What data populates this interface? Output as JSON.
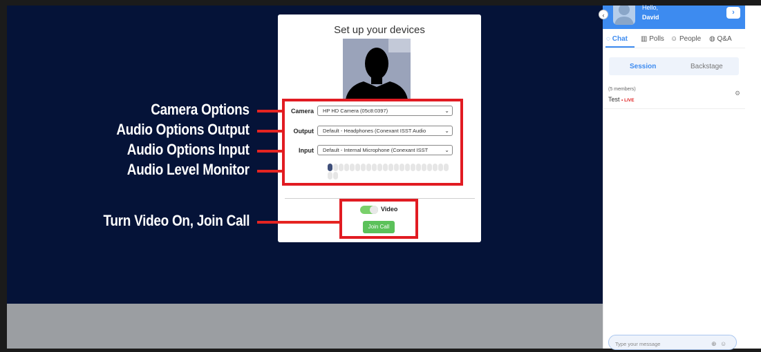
{
  "annotations": {
    "camera_options": "Camera Options",
    "audio_output": "Audio Options Output",
    "audio_input": "Audio Options Input",
    "audio_level": "Audio Level Monitor",
    "video_join": "Turn Video On, Join Call",
    "accent_color": "#e11b22"
  },
  "modal": {
    "title": "Set up your devices",
    "camera_label": "Camera",
    "camera_value": "HP HD Camera (05c8:0397)",
    "output_label": "Output",
    "output_value": "Default - Headphones (Conexant ISST Audio",
    "input_label": "Input",
    "input_value": "Default - Internal Microphone (Conexant ISST",
    "audio_level_fraction": 0.05,
    "video_label": "Video",
    "video_toggle_on": true,
    "join_label": "Join Call"
  },
  "panel": {
    "greeting": "Hello,",
    "user_name": "David",
    "tabs": [
      "Chat",
      "Polls",
      "People",
      "Q&A"
    ],
    "tab_icons": [
      "chat-bubble-icon",
      "bar-chart-icon",
      "people-icon",
      "qa-bubbles-icon"
    ],
    "active_tab": "Chat",
    "segments": [
      "Session",
      "Backstage"
    ],
    "active_segment": "Session",
    "members": "(5 members)",
    "room_name": "Test",
    "room_status": "LIVE",
    "message_placeholder": "Type your message",
    "accent_color": "#3d8bf0"
  }
}
